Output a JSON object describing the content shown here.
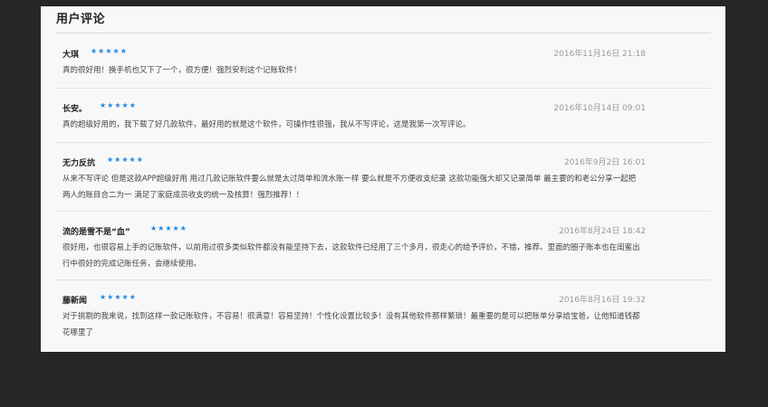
{
  "section": {
    "title": "用户评论"
  },
  "rating_color": "#1e88e5",
  "reviews": [
    {
      "author": "大琪",
      "stars": "★★★★★",
      "date": "2016年11月16日 21:18",
      "content": "真的很好用！换手机也又下了一个，很方便！强烈安利这个记账软件！"
    },
    {
      "author": "长安。",
      "stars": "★★★★★",
      "date": "2016年10月14日 09:01",
      "content": "真的超级好用的，我下载了好几款软件，最好用的就是这个软件，可操作性很强，我从不写评论，这是我第一次写评论。"
    },
    {
      "author": "无力反抗",
      "stars": "★★★★★",
      "date": "2016年9月2日 16:01",
      "content": "从来不写评论 但是这款APP超级好用 用过几款记账软件要么就是太过简单和流水账一样 要么就是不方便收支纪录 这款功能强大却又记录简单 最主要的和老公分享一起把两人的账目合二为一 满足了家庭成员收支的统一及核算！强烈推荐！！"
    },
    {
      "author": "流的是雪不是“血”",
      "stars": "★★★★★",
      "date": "2016年8月24日 18:42",
      "content": "很好用，也很容易上手的记账软件，以前用过很多类似软件都没有能坚持下去，这款软件已经用了三个多月，很走心的给予评价，不错，推荐。里面的圈子账本也在闺蜜出行中很好的完成记账任务，会继续使用。"
    },
    {
      "author": "藤新闻",
      "stars": "★★★★★",
      "date": "2016年8月16日 19:32",
      "content": "对于挑剔的我来说，找到这样一款记账软件，不容易！很满意！容易坚持！个性化设置比较多！没有其他软件那样繁琐！最重要的是可以把账单分享给宝爸，让他知道钱都花哪里了"
    }
  ]
}
